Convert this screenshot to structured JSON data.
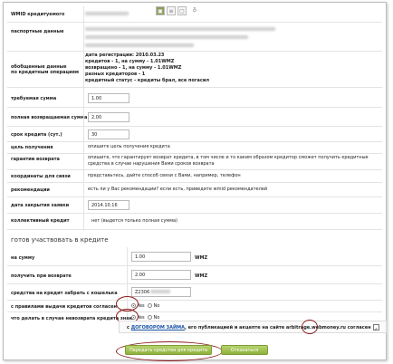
{
  "header": {
    "wmid_label": "WMID кредитуемого"
  },
  "icons": [
    "passport-icon",
    "list-icon",
    "document-icon",
    "pin-icon"
  ],
  "rows": {
    "passport_label": "паспортные данные",
    "summary_label_1": "обобщенные данные",
    "summary_label_2": "по кредитным операциям",
    "summary_lines": [
      "дата регистрации: 2010.03.23",
      "кредитов - 1, на сумму - 1.01WMZ",
      "возвращено - 1, на сумму - 1.01WMZ",
      "разных кредиторов - 1",
      "кредитный статус - кредиты брал, все погасил"
    ],
    "required_sum_label": "требуемая сумма",
    "required_sum_value": "1.00",
    "return_sum_label": "полная возвращаемая сумма",
    "return_sum_value": "2.00",
    "term_label": "срок кредита (сут.)",
    "term_value": "30",
    "purpose_label": "цель получения",
    "purpose_value": "опишите цель получения кредита",
    "guarantee_label": "гарантии возврата",
    "guarantee_value": "опишите, что гарантирует возврат кредита, в том числе и то каким образом кредитор сможет получить кредитные средства в случае нарушения Вами сроков возврата",
    "contacts_label": "координаты для связи",
    "contacts_value": "представьтесь, дайте способ связи с Вами, например, телефон",
    "recommend_label": "рекомендации",
    "recommend_value": "есть ли у Вас рекомендации? если есть, приведите wmid рекомендателей",
    "close_date_label": "дата закрытия заявки",
    "close_date_value": "2014.10.16",
    "collective_label": "коллективный кредит",
    "collective_value": "нет (выдется только полная сумма)"
  },
  "section": {
    "title": "готов участвовать в кредите",
    "amount_label": "на сумму",
    "amount_value": "1.00",
    "amount_unit": "WMZ",
    "receive_label": "получить при возврате",
    "receive_value": "2.00",
    "receive_unit": "WMZ",
    "wallet_label": "средства на кредит забрать с кошелька",
    "wallet_value": "Z2306",
    "rules_label": "с правилами выдачи кредитов согласен",
    "rules_yes": "Yes",
    "rules_no": "No",
    "overdue_label": "что делать в случае невозврата кредита знаю",
    "overdue_yes": "Yes",
    "overdue_no": "No"
  },
  "agreement": {
    "prefix": "с",
    "link": "ДОГОВОРОМ ЗАЙМА",
    "suffix": ", его публикацией и акцепте на сайте arbitrage.webmoney.ru согласен"
  },
  "buttons": {
    "submit": "Передать средства для кредита",
    "cancel": "Отказаться"
  }
}
